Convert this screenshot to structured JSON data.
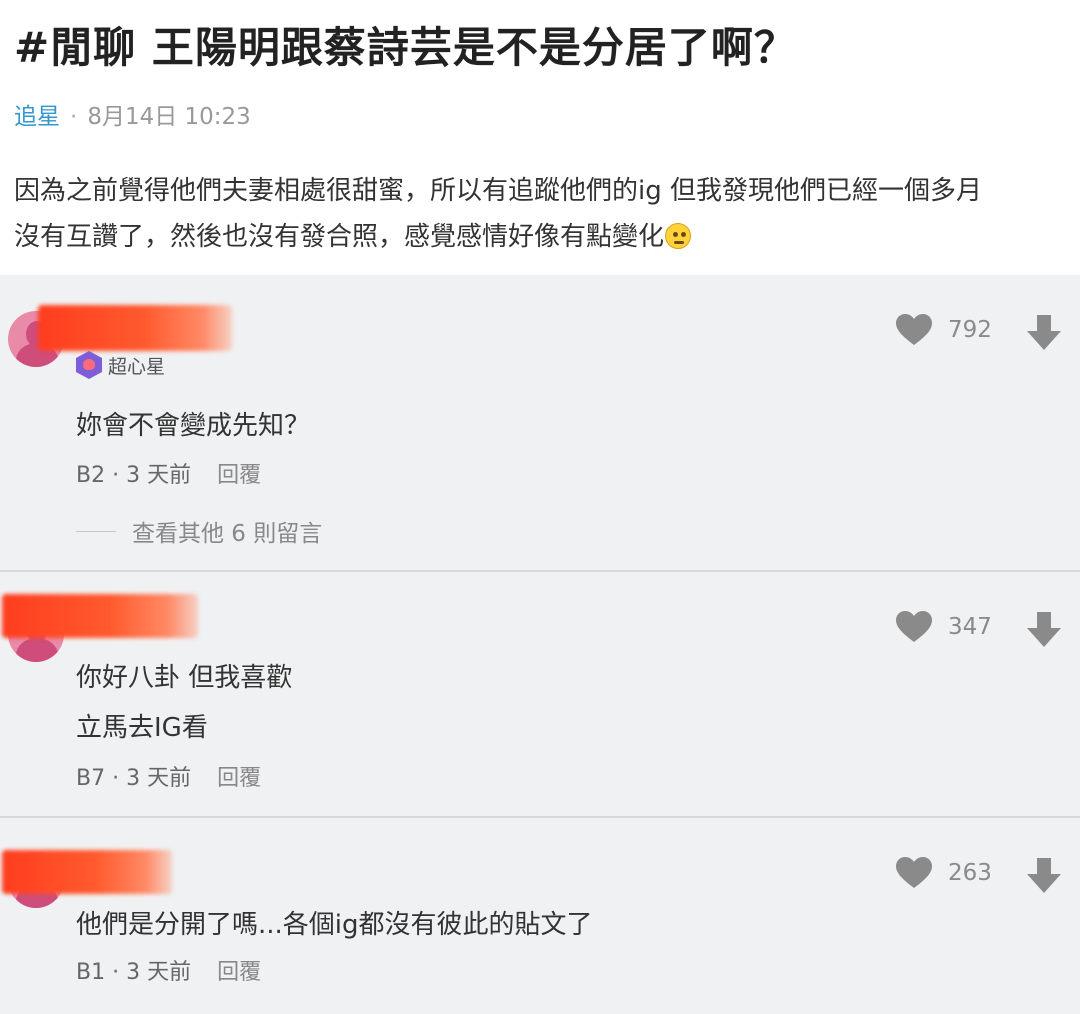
{
  "post": {
    "title": "#閒聊 王陽明跟蔡詩芸是不是分居了啊？",
    "forum": "追星",
    "separator": "·",
    "time": "8月14日 10:23",
    "body_line1": "因為之前覺得他們夫妻相處很甜蜜，所以有追蹤他們的ig 但我發現他們已經一個多月",
    "body_line2": "沒有互讚了，然後也沒有發合照，感覺感情好像有點變化",
    "emoji_icon": "face-with-monocle-emoji"
  },
  "comments": [
    {
      "badge": "超心星",
      "text_lines": [
        "妳會不會變成先知？"
      ],
      "floor": "B2",
      "time": "3 天前",
      "reply_label": "回覆",
      "likes": "792",
      "more_replies": "查看其他 6 則留言"
    },
    {
      "text_lines": [
        "你好八卦 但我喜歡",
        "立馬去IG看"
      ],
      "floor": "B7",
      "time": "3 天前",
      "reply_label": "回覆",
      "likes": "347"
    },
    {
      "text_lines": [
        "他們是分開了嗎...各個ig都沒有彼此的貼文了"
      ],
      "floor": "B1",
      "time": "3 天前",
      "reply_label": "回覆",
      "likes": "263"
    }
  ],
  "meta_separator": " · ",
  "colors": {
    "forum_link": "#3397cf",
    "comment_bg": "#f0f1f3",
    "redaction": "#ff3d1f",
    "icon_gray": "#8a8a8a"
  }
}
